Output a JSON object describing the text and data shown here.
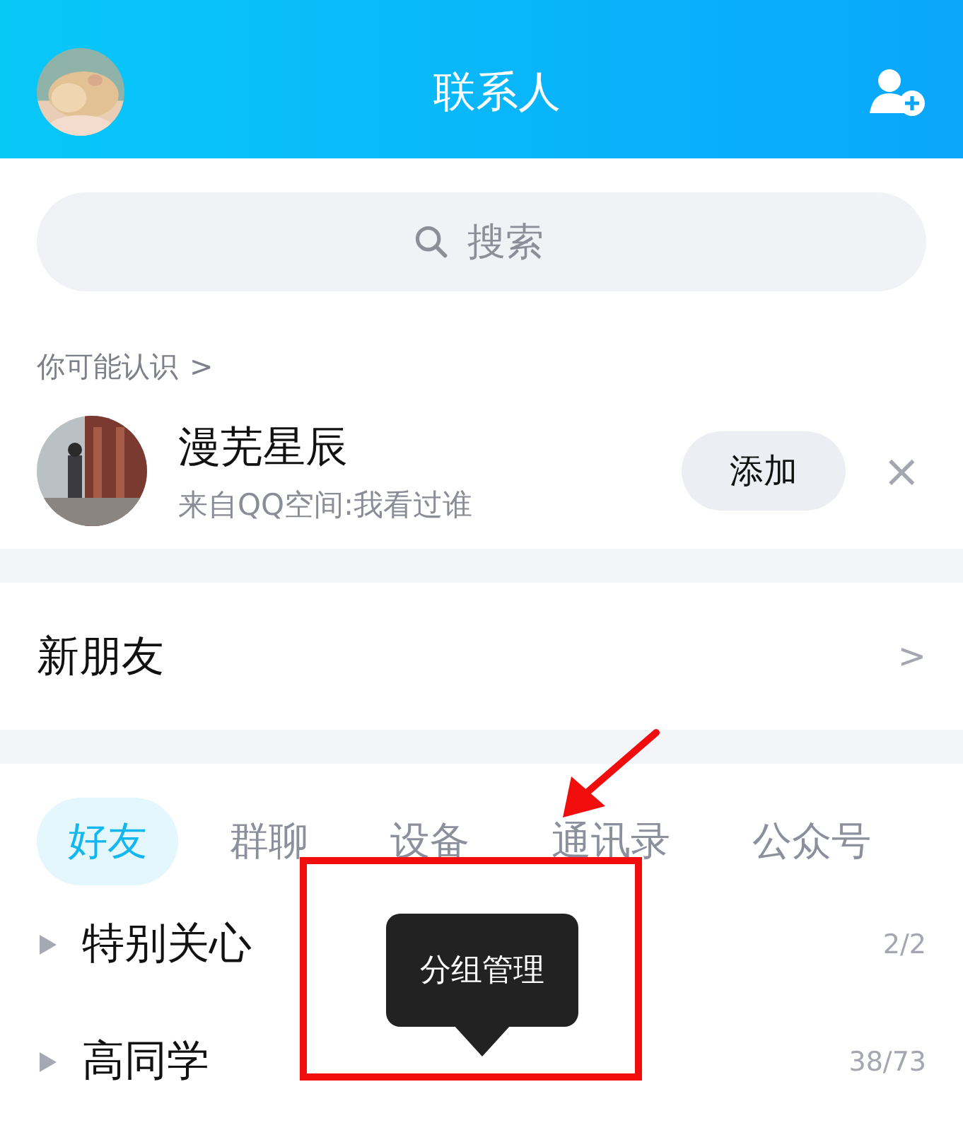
{
  "header": {
    "title": "联系人"
  },
  "search": {
    "placeholder": "搜索"
  },
  "suggestions": {
    "title": "你可能认识",
    "chevron": ">",
    "people": [
      {
        "name": "漫芜星辰",
        "source": "来自QQ空间:我看过谁",
        "action": "添加",
        "dismiss": "×"
      }
    ]
  },
  "new_friends": {
    "label": "新朋友",
    "chevron": ">"
  },
  "tabs": [
    {
      "label": "好友",
      "selected": true
    },
    {
      "label": "群聊",
      "selected": false
    },
    {
      "label": "设备",
      "selected": false
    },
    {
      "label": "通讯录",
      "selected": false
    },
    {
      "label": "公众号",
      "selected": false
    }
  ],
  "groups": [
    {
      "name": "特别关心",
      "count": "2/2",
      "expanded": false
    },
    {
      "name": "高同学",
      "count": "38/73",
      "expanded": false
    }
  ],
  "tooltip": {
    "text": "分组管理"
  }
}
